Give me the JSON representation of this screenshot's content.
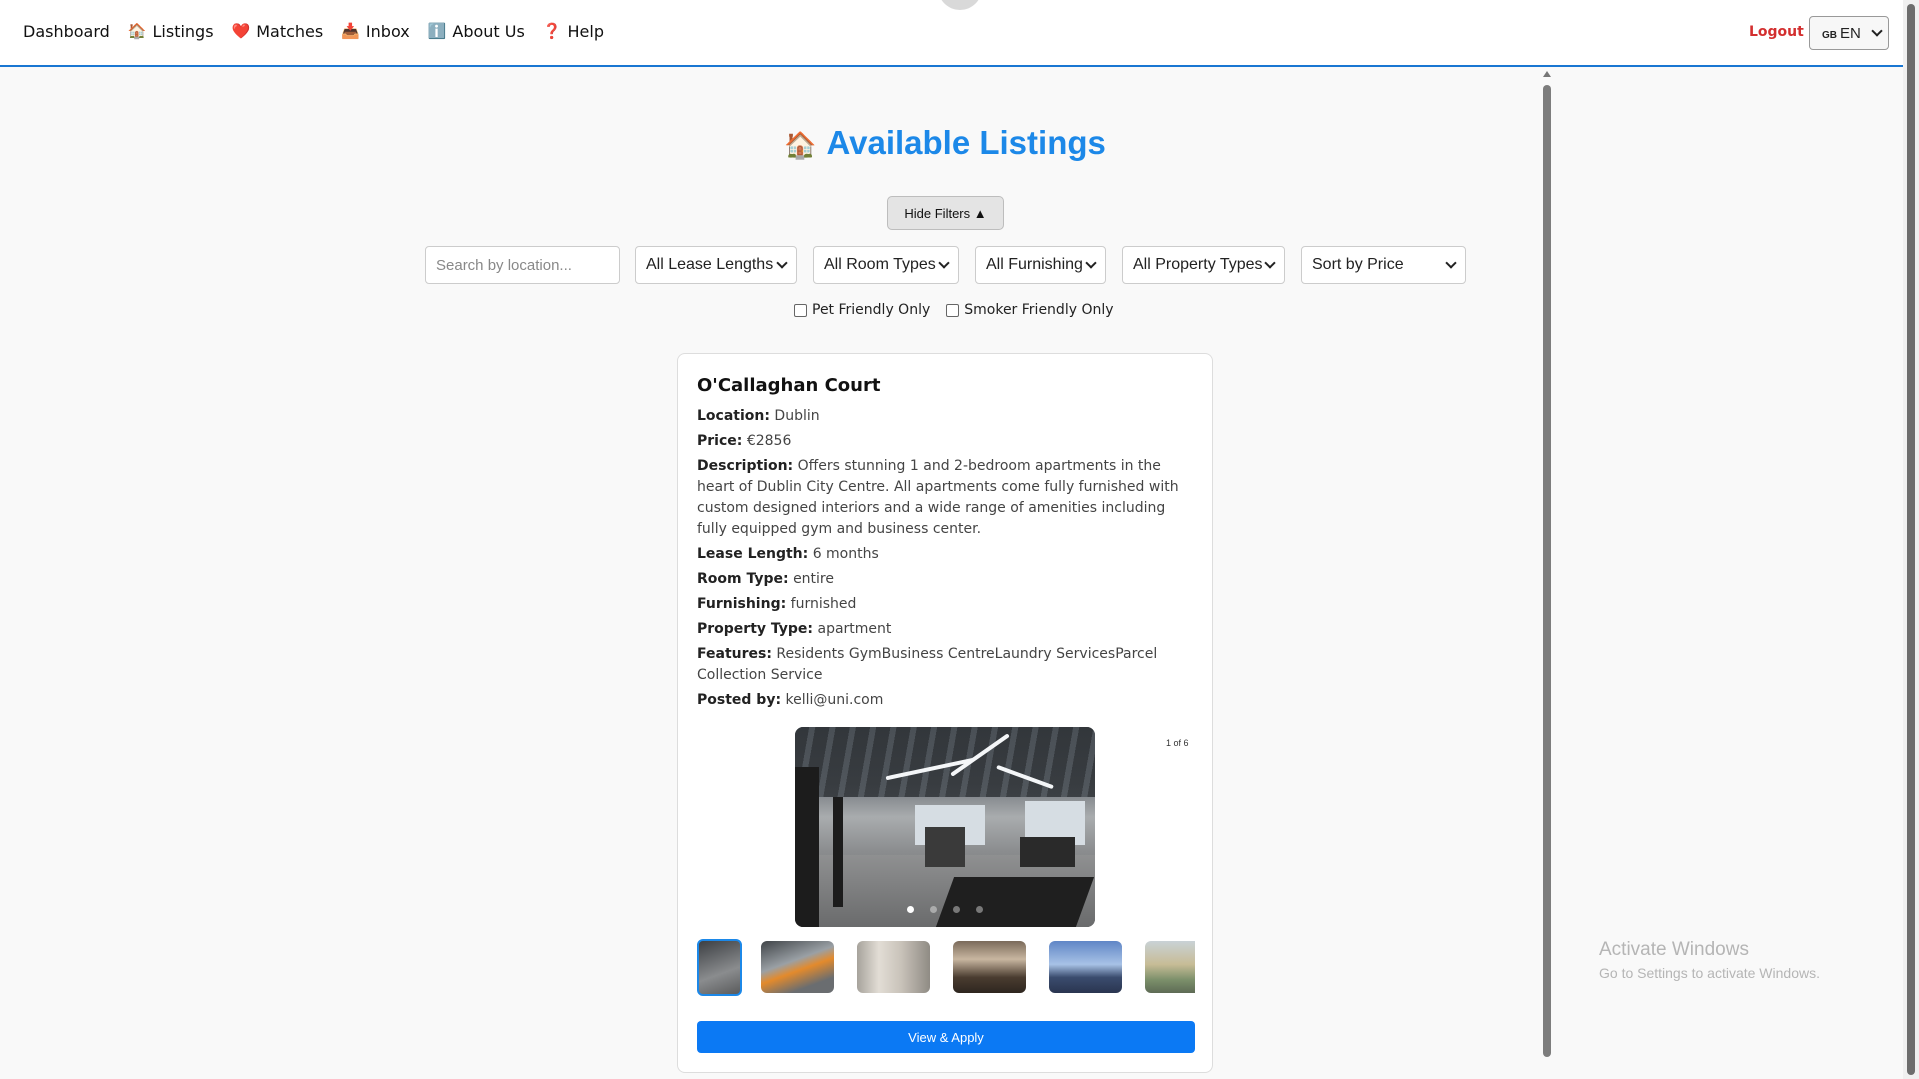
{
  "nav": {
    "items": [
      {
        "label": "Dashboard",
        "icon": ""
      },
      {
        "label": "Listings",
        "icon": "🏠"
      },
      {
        "label": "Matches",
        "icon": "❤️"
      },
      {
        "label": "Inbox",
        "icon": "📥"
      },
      {
        "label": "About Us",
        "icon": "ℹ️"
      },
      {
        "label": "Help",
        "icon": "❓"
      }
    ],
    "logout": "Logout",
    "language": {
      "flag": "GB",
      "value": "EN"
    }
  },
  "page": {
    "title_icon": "🏠",
    "title": "Available Listings",
    "hide_filters": "Hide Filters ▲"
  },
  "filters": {
    "search_placeholder": "Search by location...",
    "lease": "All Lease Lengths",
    "room": "All Room Types",
    "furnishing": "All Furnishing",
    "property": "All Property Types",
    "sort": "Sort by Price",
    "pet_friendly": "Pet Friendly Only",
    "smoker_friendly": "Smoker Friendly Only"
  },
  "listing": {
    "name": "O'Callaghan Court",
    "location_label": "Location:",
    "location": "Dublin",
    "price_label": "Price:",
    "price": "€2856",
    "description_label": "Description:",
    "description": "Offers stunning 1 and 2-bedroom apartments in the heart of Dublin City Centre. All apartments come fully furnished with custom designed interiors and a wide range of amenities including fully equipped gym and business center.",
    "lease_label": "Lease Length:",
    "lease": "6 months",
    "room_label": "Room Type:",
    "room": "entire",
    "furnishing_label": "Furnishing:",
    "furnishing": "furnished",
    "property_label": "Property Type:",
    "property": "apartment",
    "features_label": "Features:",
    "features": "Residents GymBusiness CentreLaundry ServicesParcel Collection Service",
    "posted_label": "Posted by:",
    "posted": "kelli@uni.com",
    "image_counter": "1 of 6",
    "apply": "View & Apply"
  },
  "watermark": {
    "line1": "Activate Windows",
    "line2": "Go to Settings to activate Windows."
  },
  "colors": {
    "accent": "#1c88e8",
    "button": "#0b79f4",
    "logout": "#d32f2f"
  }
}
